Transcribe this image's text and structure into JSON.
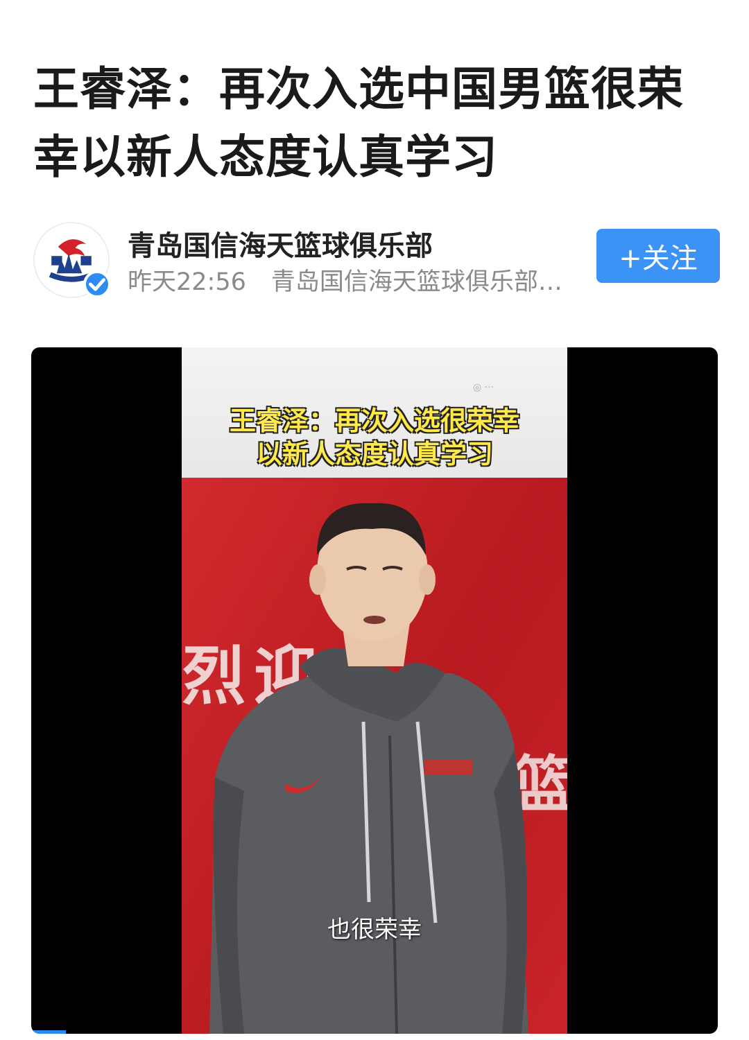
{
  "article": {
    "title": "王睿泽：再次入选中国男篮很荣幸以新人态度认真学习"
  },
  "author": {
    "name": "青岛国信海天篮球俱乐部",
    "time": "昨天22:56",
    "source": "青岛国信海天篮球俱乐部…",
    "avatar_icon": "qingdao-club-logo-icon",
    "verified_icon": "verified-check-icon",
    "follow_label": "+关注"
  },
  "video": {
    "overlay_title_line1": "王睿泽：再次入选很荣幸",
    "overlay_title_line2": "以新人态度认真学习",
    "subtitle": "也很荣幸",
    "banner_text": "烈迎",
    "banner_text_right": "篮",
    "progress": 0.05
  },
  "colors": {
    "accent": "#3a93f5",
    "banner_red": "#c62026",
    "overlay_yellow": "#ffe94a"
  }
}
